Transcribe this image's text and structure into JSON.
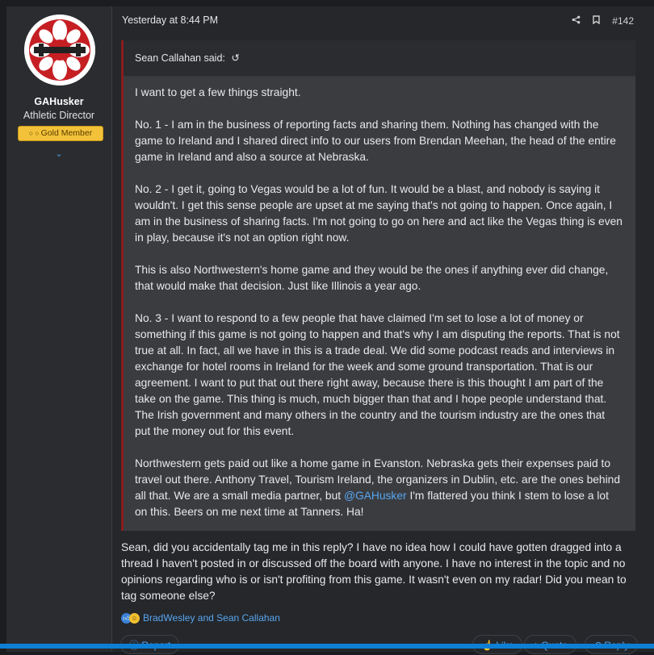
{
  "post": {
    "timestamp": "Yesterday at 8:44 PM",
    "number": "#142",
    "share_icon": "share-icon",
    "bookmark_icon": "bookmark-icon"
  },
  "user": {
    "name": "GAHusker",
    "title": "Athletic Director",
    "badge": "Gold Member",
    "expand_icon": "chevron-down-icon"
  },
  "quote": {
    "author_line": "Sean Callahan said:",
    "jump_icon": "return-arrow-icon",
    "paragraphs": [
      "I want to get a few things straight.",
      "No. 1 - I am in the business of reporting facts and sharing them. Nothing has changed with the game to Ireland and I shared direct info to our users from Brendan Meehan, the head of the entire game in Ireland and also a source at Nebraska.",
      "No. 2 - I get it, going to Vegas would be a lot of fun. It would be a blast, and nobody is saying it wouldn't. I get this sense people are upset at me saying that's not going to happen. Once again, I am in the business of sharing facts. I'm not going to go on here and act like the Vegas thing is even in play, because it's not an option right now.",
      "This is also Northwestern's home game and they would be the ones if anything ever did change, that would make that decision. Just like Illinois a year ago.",
      "No. 3 - I want to respond to a few people that have claimed I'm set to lose a lot of money or something if this game is not going to happen and that's why I am disputing the reports. That is not true at all. In fact, all we have in this is a trade deal. We did some podcast reads and interviews in exchange for hotel rooms in Ireland for the week and some ground transportation. That is our agreement. I want to put that out there right away, because there is this thought I am part of the take on the game. This thing is much, much bigger than that and I hope people understand that. The Irish government and many others in the country and the tourism industry are the ones that put the money out for this event."
    ],
    "last_para_before": "Northwestern gets paid out like a home game in Evanston. Nebraska gets their expenses paid to travel out there. Anthony Travel, Tourism Ireland, the organizers in Dublin, etc. are the ones behind all that. We are a small media partner, but ",
    "mention": "@GAHusker",
    "last_para_after": " I'm flattered you think I stem to lose a lot on this. Beers on me next time at Tanners. Ha!"
  },
  "reply_text": "Sean, did you accidentally tag me in this reply? I have no idea how I could have gotten dragged into a thread I haven't posted in or discussed off the board with anyone. I have no interest in the topic and no opinions regarding who is or isn't profiting from this game. It wasn't even on my radar! Did you mean to tag someone else?",
  "reactions": {
    "text": "BradWesley and Sean Callahan"
  },
  "buttons": {
    "report": "Report",
    "like": "Like",
    "quote": "+ Quote",
    "reply": "Reply"
  },
  "colors": {
    "accent": "#58a6f0",
    "badge": "#f3c23a",
    "quote_border": "#8a1d1d"
  }
}
